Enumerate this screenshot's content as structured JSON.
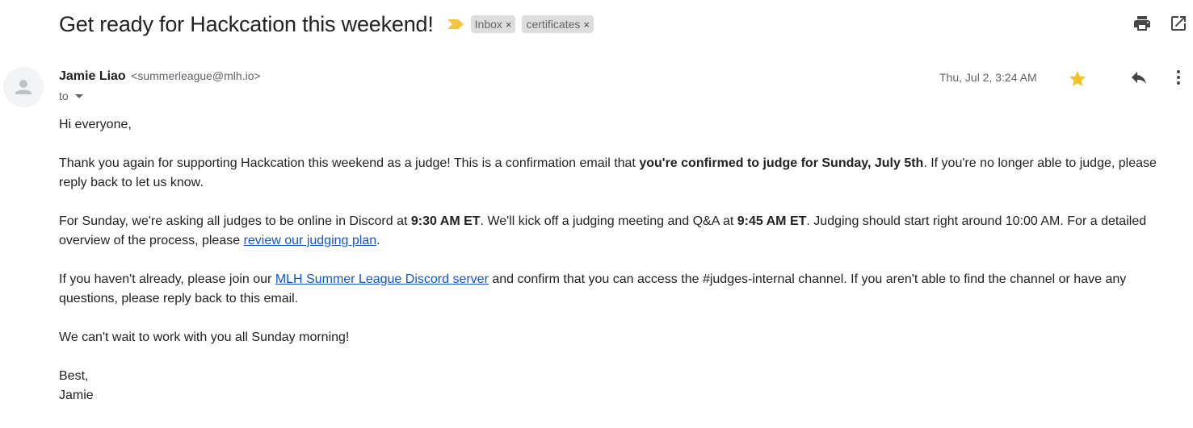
{
  "subject": "Get ready for Hackcation this weekend!",
  "labels": [
    {
      "text": "Inbox",
      "remove": "×"
    },
    {
      "text": "certificates",
      "remove": "×"
    }
  ],
  "toolbar": {
    "print_icon": "print-icon",
    "popout_icon": "open-in-new-window-icon"
  },
  "sender": {
    "name": "Jamie Liao",
    "email": "<summerleague@mlh.io>",
    "to_label": "to",
    "date": "Thu, Jul 2, 3:24 AM"
  },
  "colors": {
    "importance_marker": "#f5c342",
    "star": "#f6bf26",
    "link": "#1155cc",
    "chip_bg": "#dddddd"
  },
  "body": {
    "greeting": "Hi everyone,",
    "p1": {
      "a": "Thank you again for supporting Hackcation this weekend as a judge! This is a confirmation email that ",
      "b": "you're confirmed to judge for Sunday, July 5th",
      "c": ". If you're no longer able to judge, please reply back to let us know."
    },
    "p2": {
      "a": "For Sunday, we're asking all judges to be online in Discord at ",
      "b": "9:30 AM ET",
      "c": ". We'll kick off a judging meeting and Q&A at ",
      "d": "9:45 AM ET",
      "e": ". Judging should start right around 10:00 AM. For a detailed overview of the process, please ",
      "link": "review our judging plan",
      "f": "."
    },
    "p3": {
      "a": "If you haven't already, please join our ",
      "link": "MLH Summer League Discord server",
      "b": " and confirm that you can access the #judges-internal channel. If you aren't able to find the channel or have any questions, please reply back to this email."
    },
    "p4": "We can't wait to work with you all Sunday morning!",
    "closing": "Best,",
    "signature": "Jamie"
  }
}
